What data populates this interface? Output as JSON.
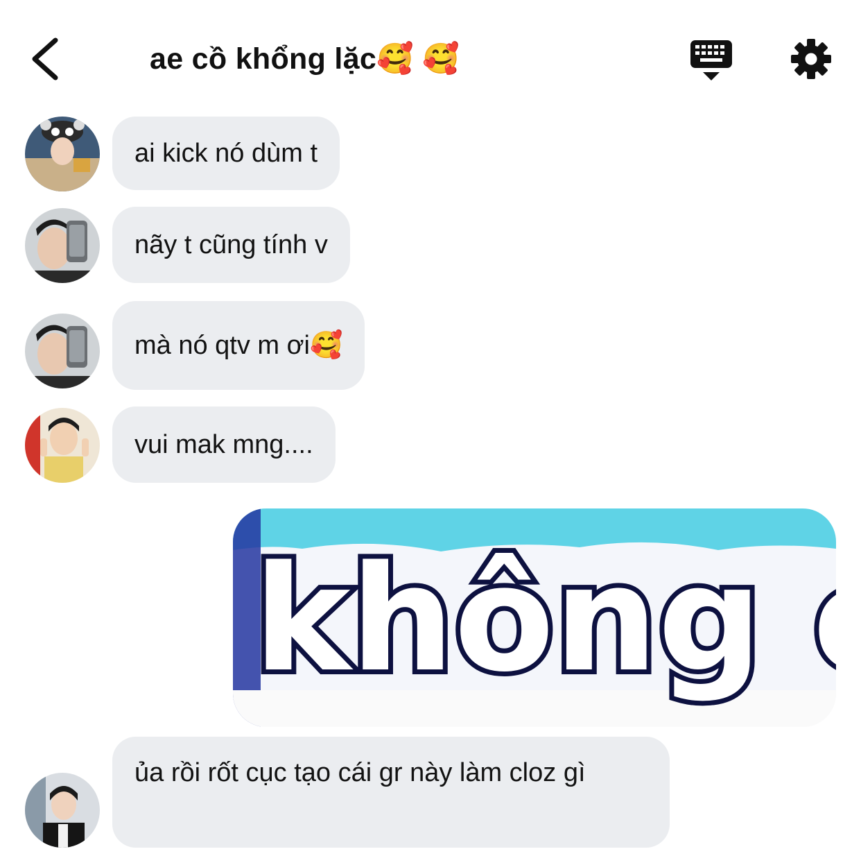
{
  "header": {
    "title": "ae cồ khổng lặc🥰 🥰",
    "back_icon": "chevron-left-icon",
    "keyboard_icon": "keyboard-hide-icon",
    "settings_icon": "gear-icon"
  },
  "messages": [
    {
      "sender": "incoming",
      "avatar_icon": "avatar-photo",
      "text": "ai kick nó dùm t"
    },
    {
      "sender": "incoming",
      "avatar_icon": "avatar-photo",
      "text": "nãy t cũng tính v"
    },
    {
      "sender": "incoming",
      "avatar_icon": "avatar-photo",
      "text": "mà nó qtv m ơi🥰"
    },
    {
      "sender": "incoming",
      "avatar_icon": "avatar-photo",
      "text": "vui mak mng...."
    },
    {
      "sender": "outgoing",
      "type": "image",
      "image_text": "không em"
    },
    {
      "sender": "incoming",
      "avatar_icon": "avatar-photo",
      "text": "ủa rồi rốt cục tạo cái gr này làm cloz gì"
    }
  ],
  "colors": {
    "bubble_bg": "#ebedf0",
    "text": "#121212",
    "sticker_sky": "#5fd3e6",
    "sticker_border": "#1a237e"
  }
}
